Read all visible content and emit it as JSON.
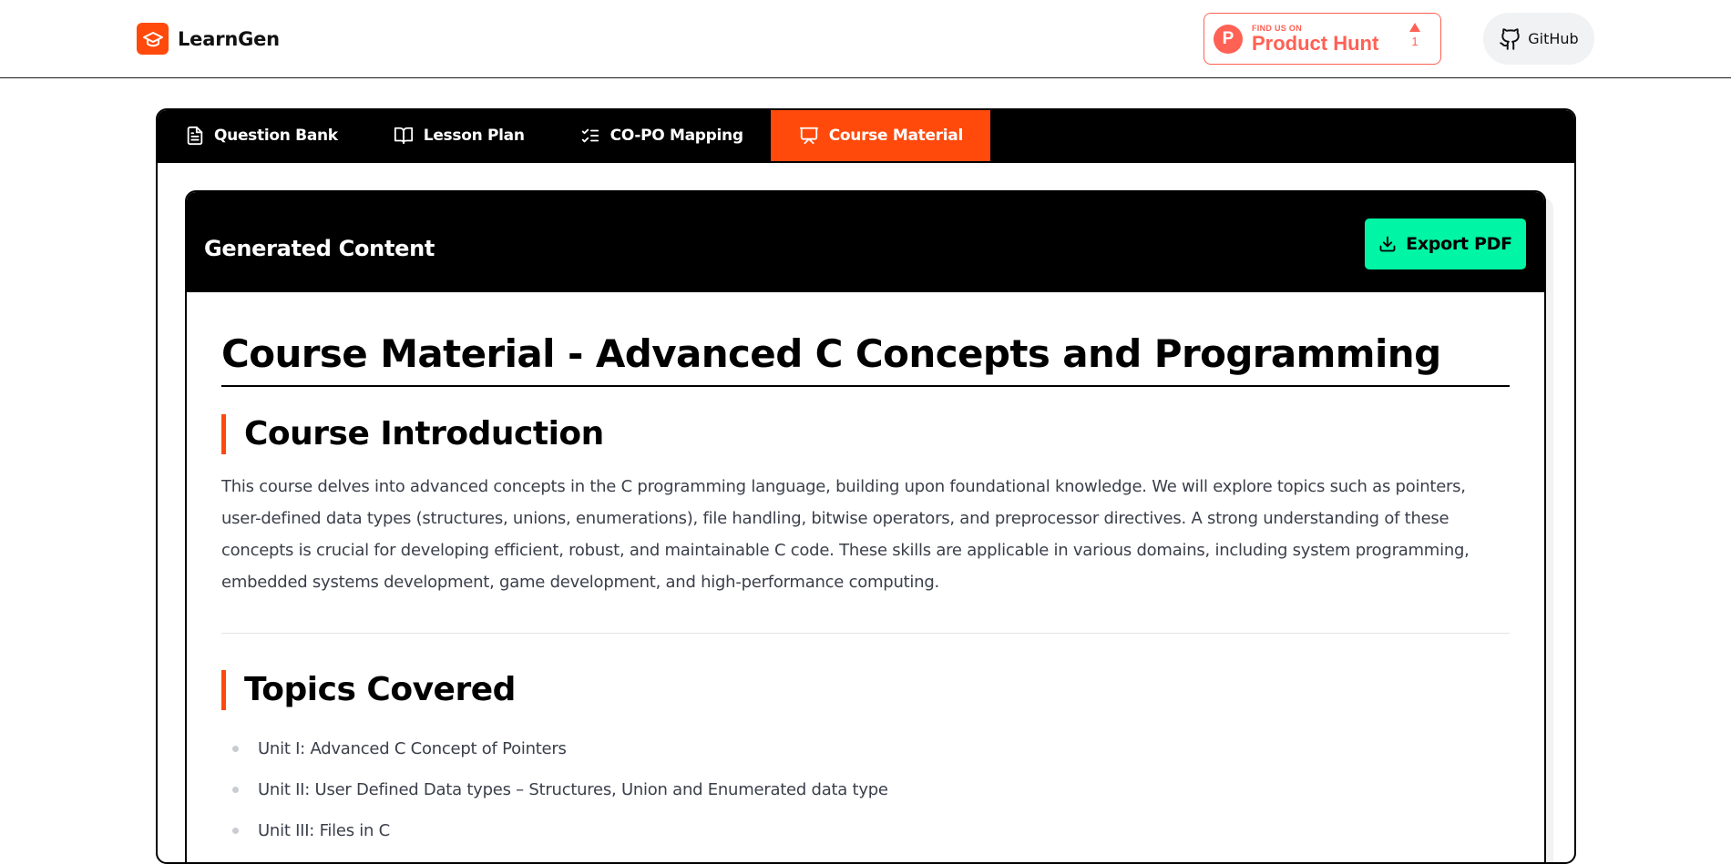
{
  "header": {
    "brand_name": "LearnGen",
    "producthunt": {
      "small_label": "FIND US ON",
      "name": "Product Hunt",
      "logo_letter": "P",
      "votes": "1"
    },
    "github_label": "GitHub"
  },
  "tabs": [
    {
      "label": "Question Bank",
      "icon": "document-icon",
      "active": false
    },
    {
      "label": "Lesson Plan",
      "icon": "book-open-icon",
      "active": false
    },
    {
      "label": "CO-PO Mapping",
      "icon": "checklist-icon",
      "active": false
    },
    {
      "label": "Course Material",
      "icon": "presentation-icon",
      "active": true
    }
  ],
  "panel": {
    "title": "Generated Content",
    "export_label": "Export PDF"
  },
  "document": {
    "title": "Course Material - Advanced C Concepts and Programming",
    "intro_heading": "Course Introduction",
    "intro_text": "This course delves into advanced concepts in the C programming language, building upon foundational knowledge. We will explore topics such as pointers, user-defined data types (structures, unions, enumerations), file handling, bitwise operators, and preprocessor directives. A strong understanding of these concepts is crucial for developing efficient, robust, and maintainable C code. These skills are applicable in various domains, including system programming, embedded systems development, game development, and high-performance computing.",
    "topics_heading": "Topics Covered",
    "topics": [
      "Unit I: Advanced C Concept of Pointers",
      "Unit II: User Defined Data types – Structures, Union and Enumerated data type",
      "Unit III: Files in C"
    ]
  },
  "colors": {
    "accent": "#ff4a0c",
    "export_button": "#00f5a4",
    "producthunt": "#ff6154"
  }
}
